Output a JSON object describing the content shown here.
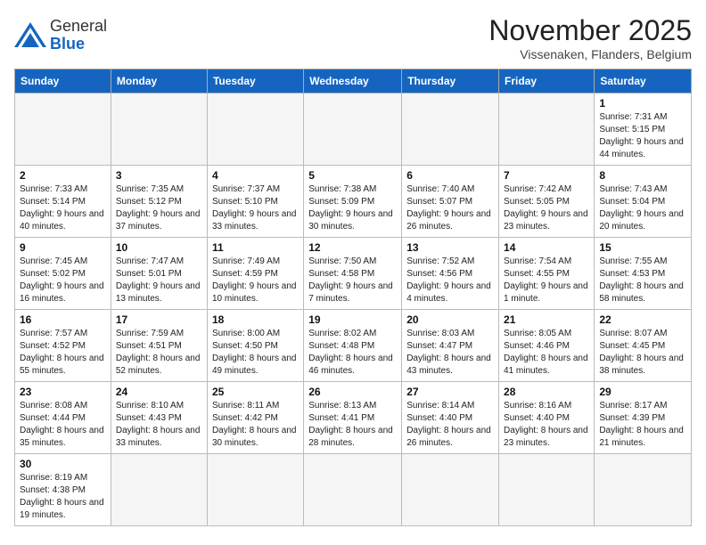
{
  "header": {
    "title": "November 2025",
    "location": "Vissenaken, Flanders, Belgium",
    "logo_general": "General",
    "logo_blue": "Blue"
  },
  "weekdays": [
    "Sunday",
    "Monday",
    "Tuesday",
    "Wednesday",
    "Thursday",
    "Friday",
    "Saturday"
  ],
  "weeks": [
    [
      {
        "day": "",
        "info": ""
      },
      {
        "day": "",
        "info": ""
      },
      {
        "day": "",
        "info": ""
      },
      {
        "day": "",
        "info": ""
      },
      {
        "day": "",
        "info": ""
      },
      {
        "day": "",
        "info": ""
      },
      {
        "day": "1",
        "info": "Sunrise: 7:31 AM\nSunset: 5:15 PM\nDaylight: 9 hours and 44 minutes."
      }
    ],
    [
      {
        "day": "2",
        "info": "Sunrise: 7:33 AM\nSunset: 5:14 PM\nDaylight: 9 hours and 40 minutes."
      },
      {
        "day": "3",
        "info": "Sunrise: 7:35 AM\nSunset: 5:12 PM\nDaylight: 9 hours and 37 minutes."
      },
      {
        "day": "4",
        "info": "Sunrise: 7:37 AM\nSunset: 5:10 PM\nDaylight: 9 hours and 33 minutes."
      },
      {
        "day": "5",
        "info": "Sunrise: 7:38 AM\nSunset: 5:09 PM\nDaylight: 9 hours and 30 minutes."
      },
      {
        "day": "6",
        "info": "Sunrise: 7:40 AM\nSunset: 5:07 PM\nDaylight: 9 hours and 26 minutes."
      },
      {
        "day": "7",
        "info": "Sunrise: 7:42 AM\nSunset: 5:05 PM\nDaylight: 9 hours and 23 minutes."
      },
      {
        "day": "8",
        "info": "Sunrise: 7:43 AM\nSunset: 5:04 PM\nDaylight: 9 hours and 20 minutes."
      }
    ],
    [
      {
        "day": "9",
        "info": "Sunrise: 7:45 AM\nSunset: 5:02 PM\nDaylight: 9 hours and 16 minutes."
      },
      {
        "day": "10",
        "info": "Sunrise: 7:47 AM\nSunset: 5:01 PM\nDaylight: 9 hours and 13 minutes."
      },
      {
        "day": "11",
        "info": "Sunrise: 7:49 AM\nSunset: 4:59 PM\nDaylight: 9 hours and 10 minutes."
      },
      {
        "day": "12",
        "info": "Sunrise: 7:50 AM\nSunset: 4:58 PM\nDaylight: 9 hours and 7 minutes."
      },
      {
        "day": "13",
        "info": "Sunrise: 7:52 AM\nSunset: 4:56 PM\nDaylight: 9 hours and 4 minutes."
      },
      {
        "day": "14",
        "info": "Sunrise: 7:54 AM\nSunset: 4:55 PM\nDaylight: 9 hours and 1 minute."
      },
      {
        "day": "15",
        "info": "Sunrise: 7:55 AM\nSunset: 4:53 PM\nDaylight: 8 hours and 58 minutes."
      }
    ],
    [
      {
        "day": "16",
        "info": "Sunrise: 7:57 AM\nSunset: 4:52 PM\nDaylight: 8 hours and 55 minutes."
      },
      {
        "day": "17",
        "info": "Sunrise: 7:59 AM\nSunset: 4:51 PM\nDaylight: 8 hours and 52 minutes."
      },
      {
        "day": "18",
        "info": "Sunrise: 8:00 AM\nSunset: 4:50 PM\nDaylight: 8 hours and 49 minutes."
      },
      {
        "day": "19",
        "info": "Sunrise: 8:02 AM\nSunset: 4:48 PM\nDaylight: 8 hours and 46 minutes."
      },
      {
        "day": "20",
        "info": "Sunrise: 8:03 AM\nSunset: 4:47 PM\nDaylight: 8 hours and 43 minutes."
      },
      {
        "day": "21",
        "info": "Sunrise: 8:05 AM\nSunset: 4:46 PM\nDaylight: 8 hours and 41 minutes."
      },
      {
        "day": "22",
        "info": "Sunrise: 8:07 AM\nSunset: 4:45 PM\nDaylight: 8 hours and 38 minutes."
      }
    ],
    [
      {
        "day": "23",
        "info": "Sunrise: 8:08 AM\nSunset: 4:44 PM\nDaylight: 8 hours and 35 minutes."
      },
      {
        "day": "24",
        "info": "Sunrise: 8:10 AM\nSunset: 4:43 PM\nDaylight: 8 hours and 33 minutes."
      },
      {
        "day": "25",
        "info": "Sunrise: 8:11 AM\nSunset: 4:42 PM\nDaylight: 8 hours and 30 minutes."
      },
      {
        "day": "26",
        "info": "Sunrise: 8:13 AM\nSunset: 4:41 PM\nDaylight: 8 hours and 28 minutes."
      },
      {
        "day": "27",
        "info": "Sunrise: 8:14 AM\nSunset: 4:40 PM\nDaylight: 8 hours and 26 minutes."
      },
      {
        "day": "28",
        "info": "Sunrise: 8:16 AM\nSunset: 4:40 PM\nDaylight: 8 hours and 23 minutes."
      },
      {
        "day": "29",
        "info": "Sunrise: 8:17 AM\nSunset: 4:39 PM\nDaylight: 8 hours and 21 minutes."
      }
    ],
    [
      {
        "day": "30",
        "info": "Sunrise: 8:19 AM\nSunset: 4:38 PM\nDaylight: 8 hours and 19 minutes."
      },
      {
        "day": "",
        "info": ""
      },
      {
        "day": "",
        "info": ""
      },
      {
        "day": "",
        "info": ""
      },
      {
        "day": "",
        "info": ""
      },
      {
        "day": "",
        "info": ""
      },
      {
        "day": "",
        "info": ""
      }
    ]
  ]
}
